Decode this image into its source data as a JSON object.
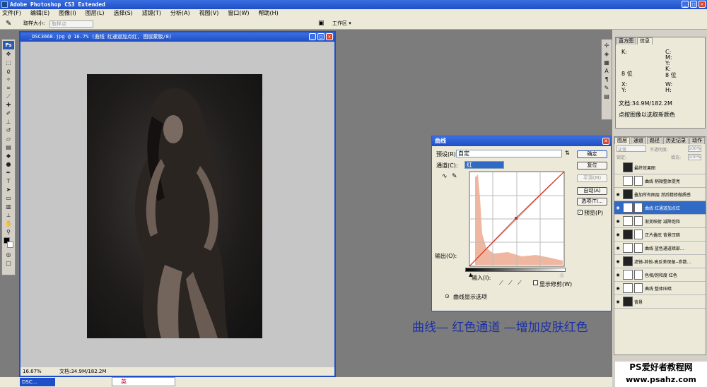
{
  "app": {
    "title": "Adobe Photoshop CS3 Extended"
  },
  "menu": [
    "文件(F)",
    "编辑(E)",
    "图像(I)",
    "图层(L)",
    "选择(S)",
    "滤镜(T)",
    "分析(A)",
    "视图(V)",
    "窗口(W)",
    "帮助(H)"
  ],
  "options": {
    "sample_label": "取样大小:",
    "sample_value": "取样点",
    "workspace": "工作区 ▾"
  },
  "document": {
    "title": "_DSC3668.jpg @ 16.7% (曲线 红通道加点红, 图层蒙版/8)",
    "zoom": "16.67%",
    "size": "文档:34.9M/182.2M"
  },
  "curves": {
    "title": "曲线",
    "preset_label": "预设(R):",
    "preset_value": "自定",
    "channel_label": "通道(C):",
    "channel_value": "红",
    "output_label": "输出(O):",
    "input_label": "输入(I):",
    "show_clip": "显示修剪(W)",
    "curve_display": "曲线显示选项",
    "buttons": {
      "ok": "确定",
      "reset": "复位",
      "smooth": "平滑(M)",
      "auto": "自动(A)",
      "options": "选项(T)...",
      "preview": "预览(P)"
    }
  },
  "info_panel": {
    "tabs": [
      "直方图",
      "信息"
    ],
    "labels": {
      "k": "K:",
      "c": "C:",
      "m": "M:",
      "y": "Y:",
      "depth_left": "8 位",
      "depth_right": "8 位",
      "x": "X:",
      "yy": "Y:",
      "w": "W:",
      "h": "H:"
    },
    "doc": "文档:34.9M/182.2M",
    "hint": "点按图像以选取新颜色"
  },
  "layers_panel": {
    "tabs": [
      "图层",
      "通道",
      "路径",
      "历史记录",
      "动作"
    ],
    "blend": "正常",
    "opacity_label": "不透明度:",
    "opacity": "100%",
    "lock_label": "锁定:",
    "fill_label": "填充:",
    "fill": "100%",
    "layers": [
      {
        "name": "最终效果图",
        "eye": false,
        "adj": false,
        "mask": false,
        "sel": false
      },
      {
        "name": "曲线 稍微整体提亮",
        "eye": false,
        "adj": true,
        "mask": true,
        "sel": false
      },
      {
        "name": "叠加所有图层 然后精修做质感",
        "eye": true,
        "adj": false,
        "mask": false,
        "sel": false
      },
      {
        "name": "曲线 红通道加点红",
        "eye": true,
        "adj": true,
        "mask": true,
        "sel": true
      },
      {
        "name": "渐变映射 减降饱和",
        "eye": true,
        "adj": true,
        "mask": true,
        "sel": false
      },
      {
        "name": "正片叠底 背景压暗",
        "eye": true,
        "adj": false,
        "mask": true,
        "sel": false
      },
      {
        "name": "曲线 蓝色通道暗部...",
        "eye": true,
        "adj": true,
        "mask": true,
        "sel": false
      },
      {
        "name": "滤镜-其他-高反差保留--参数...",
        "eye": true,
        "adj": false,
        "mask": false,
        "sel": false
      },
      {
        "name": "色相/饱和度 红色",
        "eye": true,
        "adj": true,
        "mask": true,
        "sel": false
      },
      {
        "name": "曲线 整体压暗",
        "eye": true,
        "adj": true,
        "mask": true,
        "sel": false
      },
      {
        "name": "背景",
        "eye": true,
        "adj": false,
        "mask": false,
        "sel": false
      }
    ]
  },
  "caption": "曲线— 红色通道 —增加皮肤红色",
  "watermark": {
    "line1": "PS爱好者教程网",
    "line2": "www.psahz.com"
  },
  "taskbar": {
    "doc": "DSC...",
    "ime": "英"
  },
  "colors": {
    "accent": "#1f4fc8",
    "caption": "#1a2fa8",
    "histogram": "#f0b7a0"
  }
}
